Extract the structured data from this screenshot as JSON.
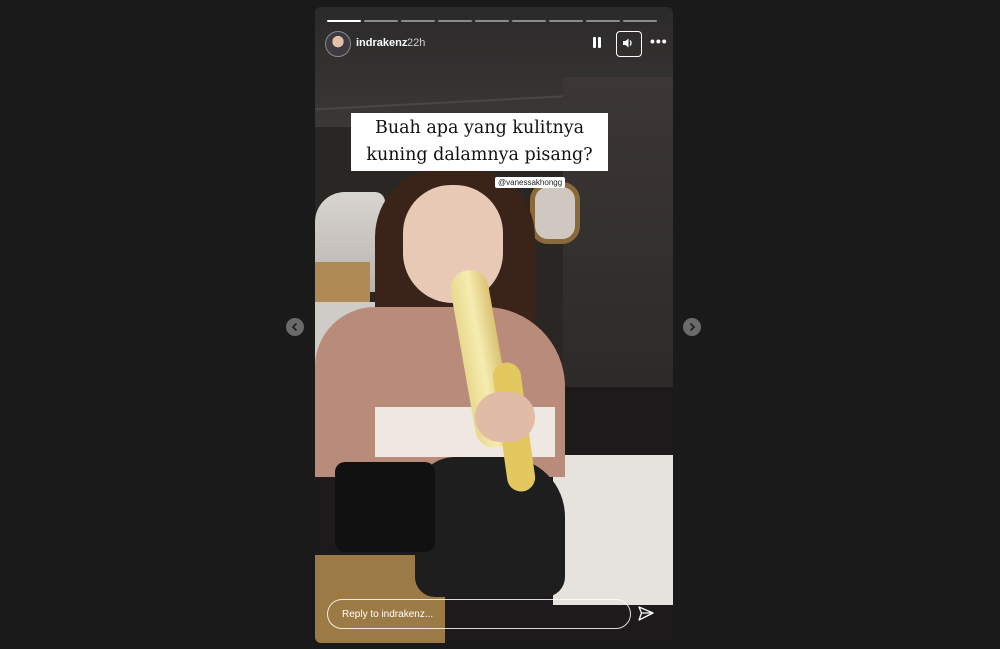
{
  "story": {
    "username": "indrakenz",
    "time_ago": "22h",
    "progress_segments": 9,
    "active_segment": 1,
    "caption_line1": "Buah apa yang kulitnya",
    "caption_line2": "kuning dalamnya pisang?",
    "mention": "@vanessakhongg",
    "reply_placeholder": "Reply to indrakenz...",
    "more_label": "•••"
  },
  "icons": {
    "pause": "pause-icon",
    "sound": "speaker-icon",
    "more": "more-dots-icon",
    "send": "send-icon",
    "prev": "chevron-left-icon",
    "next": "chevron-right-icon"
  },
  "colors": {
    "background": "#1a1a1a",
    "caption_bg": "#ffffff"
  }
}
